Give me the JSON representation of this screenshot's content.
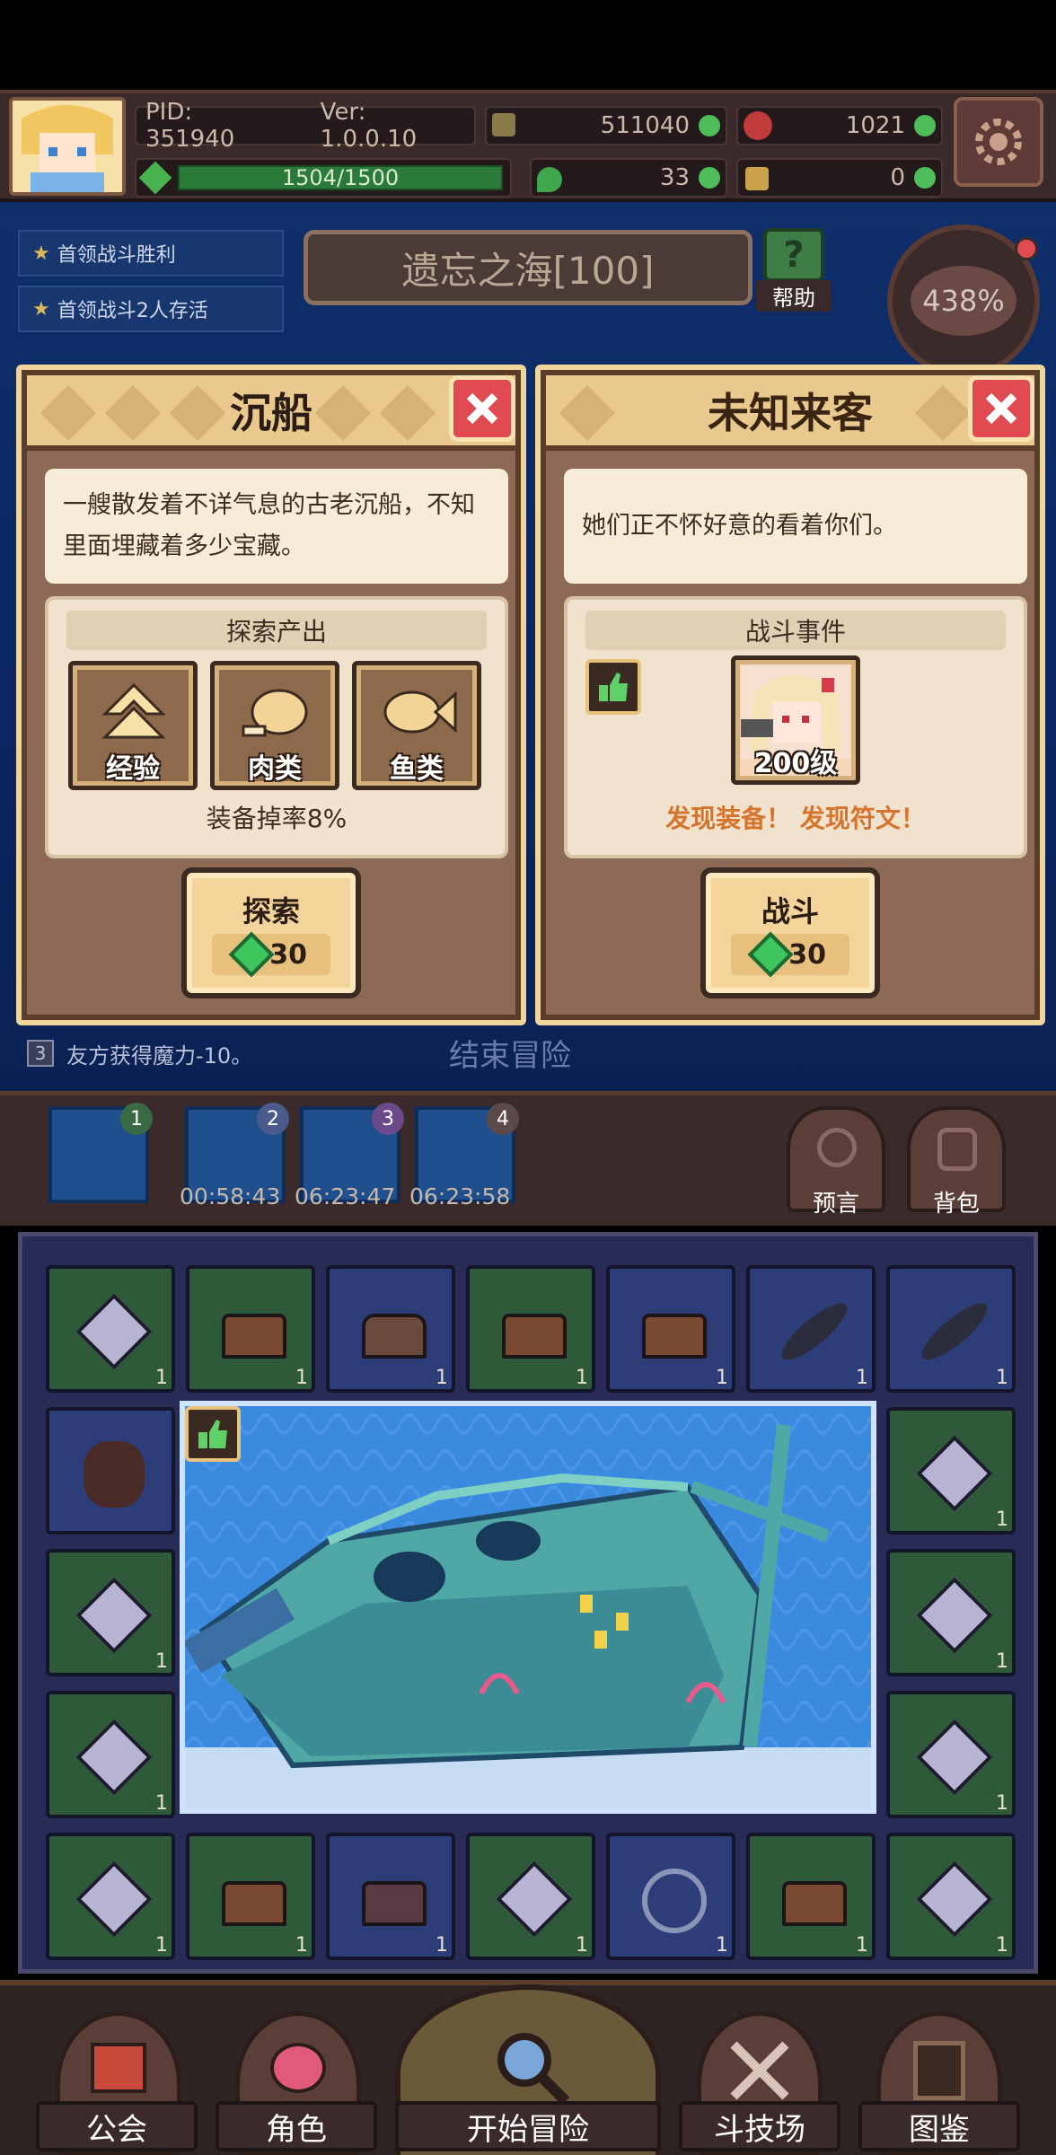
{
  "top": {
    "pid": "PID: 351940",
    "version": "Ver: 1.0.0.10",
    "gold": "511040",
    "apple": "1021",
    "stamina": "1504/1500",
    "clover": "33",
    "key": "0"
  },
  "quests": [
    "首领战斗胜利",
    "首领战斗2人存活"
  ],
  "zone": {
    "title": "遗忘之海[100]",
    "help": "帮助"
  },
  "difficulty": {
    "percent": "438%"
  },
  "dialog_left": {
    "title": "沉船",
    "desc": "一艘散发着不详气息的古老沉船，不知里面埋藏着多少宝藏。",
    "section_title": "探索产出",
    "rewards": [
      "经验",
      "肉类",
      "鱼类"
    ],
    "drop_rate": "装备掉率8%",
    "action": "探索",
    "cost": "30"
  },
  "dialog_right": {
    "title": "未知来客",
    "desc": "她们正不怀好意的看着你们。",
    "section_title": "战斗事件",
    "enemy_level": "200级",
    "note": "发现装备！ 发现符文！",
    "action": "战斗",
    "cost": "30"
  },
  "log": {
    "num": "3",
    "text": "友方获得魔力-10。",
    "end_label": "结束冒险"
  },
  "slots": [
    {
      "num": "1",
      "timer": ""
    },
    {
      "num": "2",
      "timer": "00:58:43"
    },
    {
      "num": "3",
      "timer": "06:23:47"
    },
    {
      "num": "4",
      "timer": "06:23:58"
    }
  ],
  "side_buttons": {
    "prophecy": "预言",
    "bag": "背包"
  },
  "item_count": "1",
  "nav": [
    "公会",
    "角色",
    "开始冒险",
    "斗技场",
    "图鉴"
  ],
  "colors": {
    "accent": "#f0d59a",
    "danger": "#e04a50",
    "gem": "#3ec55e",
    "note": "#d5742c"
  }
}
